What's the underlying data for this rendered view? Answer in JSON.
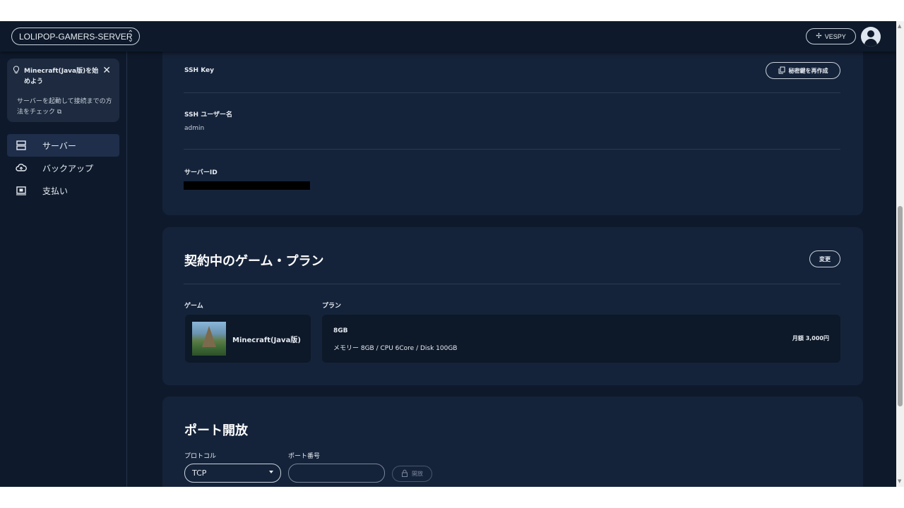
{
  "header": {
    "server_name": "LOLIPOP-GAMERS-SERVER",
    "user_name": "VESPY"
  },
  "sidebar": {
    "tip": {
      "title": "Minecraft(Java版)を始めよう",
      "body": "サーバーを起動して接続までの方法をチェック"
    },
    "items": [
      {
        "label": "サーバー",
        "icon": "server-icon",
        "active": true
      },
      {
        "label": "バックアップ",
        "icon": "cloud-upload-icon",
        "active": false
      },
      {
        "label": "支払い",
        "icon": "payment-icon",
        "active": false
      }
    ]
  },
  "ssh": {
    "key_label": "SSH Key",
    "regenerate_label": "秘密鍵を再作成",
    "user_label": "SSH ユーザー名",
    "user_value": "admin",
    "server_id_label": "サーバーID"
  },
  "plan_section": {
    "title": "契約中のゲーム・プラン",
    "change_label": "変更",
    "game_label": "ゲーム",
    "plan_label": "プラン",
    "game_name": "Minecraft(Java版)",
    "plan_name": "8GB",
    "plan_spec": "メモリー 8GB / CPU 6Core / Disk 100GB",
    "plan_price": "月額 3,000円"
  },
  "port_section": {
    "title": "ポート開放",
    "protocol_label": "プロトコル",
    "port_label": "ポート番号",
    "protocol_value": "TCP",
    "port_value": "",
    "open_label": "開放"
  }
}
